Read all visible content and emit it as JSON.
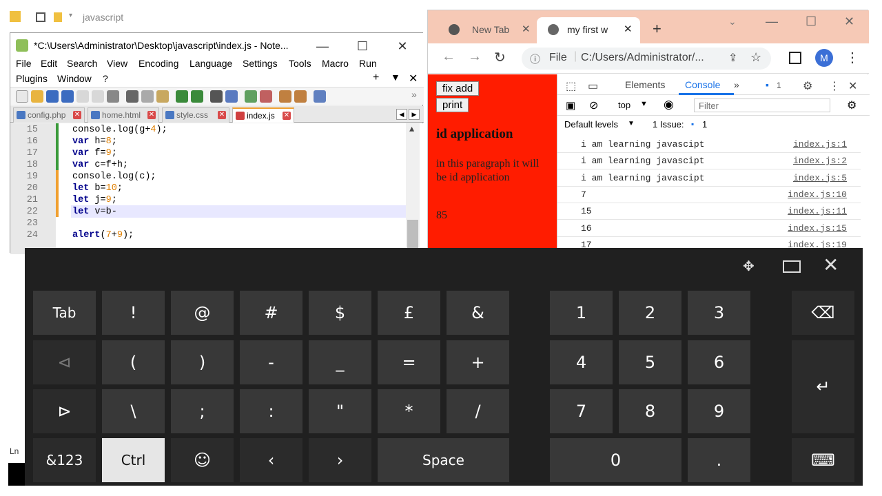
{
  "explorer": {
    "path": "javascript"
  },
  "notepad": {
    "title": "*C:\\Users\\Administrator\\Desktop\\javascript\\index.js - Note...",
    "menu": [
      "File",
      "Edit",
      "Search",
      "View",
      "Encoding",
      "Language",
      "Settings",
      "Tools",
      "Macro",
      "Run",
      "Plugins",
      "Window",
      "?"
    ],
    "tabs": [
      "config.php",
      "home.html",
      "style.css",
      "index.js"
    ],
    "active_tab": "index.js",
    "status_fragment": "Ln",
    "lines": [
      {
        "n": "15",
        "code": "console.log(g+4);"
      },
      {
        "n": "16",
        "code": "var h=8;"
      },
      {
        "n": "17",
        "code": "var f=9;"
      },
      {
        "n": "18",
        "code": "var c=f+h;"
      },
      {
        "n": "19",
        "code": "console.log(c);"
      },
      {
        "n": "20",
        "code": "let b=10;"
      },
      {
        "n": "21",
        "code": "let j=9;"
      },
      {
        "n": "22",
        "code": "let v=b-"
      },
      {
        "n": "23",
        "code": ""
      },
      {
        "n": "24",
        "code": "alert(7+9);"
      }
    ]
  },
  "browser": {
    "tabs": [
      {
        "label": "New Tab"
      },
      {
        "label": "my first w"
      }
    ],
    "new_tab": "+",
    "url_scheme": "File",
    "url": "C:/Users/Administrator/...",
    "profile_initial": "M",
    "page": {
      "buttons": [
        "fix add",
        "print"
      ],
      "heading": "id application",
      "paragraph": "in this paragraph it will be id application",
      "number": "85"
    },
    "devtools": {
      "tabs": [
        "Elements",
        "Console"
      ],
      "active": "Console",
      "issues_badge": "1",
      "context": "top",
      "filter_placeholder": "Filter",
      "levels": "Default levels",
      "issues_text": "1 Issue:",
      "issues_count": "1",
      "logs": [
        {
          "msg": "i am learning javascipt",
          "src": "index.js:1"
        },
        {
          "msg": "i am learning javascipt",
          "src": "index.js:2"
        },
        {
          "msg": "i am learning javascipt",
          "src": "index.js:5"
        },
        {
          "msg": "7",
          "src": "index.js:10"
        },
        {
          "msg": "15",
          "src": "index.js:11"
        },
        {
          "msg": "16",
          "src": "index.js:15"
        },
        {
          "msg": "17",
          "src": "index.js:19"
        }
      ]
    }
  },
  "keyboard": {
    "row1": [
      "Tab",
      "!",
      "@",
      "#",
      "$",
      "£",
      "&"
    ],
    "row2": [
      "(",
      ")",
      "-",
      "_",
      "=",
      "+"
    ],
    "row3": [
      "\\",
      ";",
      ":",
      "\"",
      "*",
      "/"
    ],
    "row4": [
      "&123",
      "Ctrl",
      "Space"
    ],
    "numpad": [
      "1",
      "2",
      "3",
      "4",
      "5",
      "6",
      "7",
      "8",
      "9",
      "0",
      "."
    ],
    "icons": [
      "move-icon",
      "dock-icon",
      "close-icon",
      "backspace-icon",
      "enter-icon",
      "keyboard-icon",
      "emoji-icon",
      "left-arrow-icon",
      "right-arrow-icon",
      "prev-icon",
      "next-icon"
    ]
  }
}
